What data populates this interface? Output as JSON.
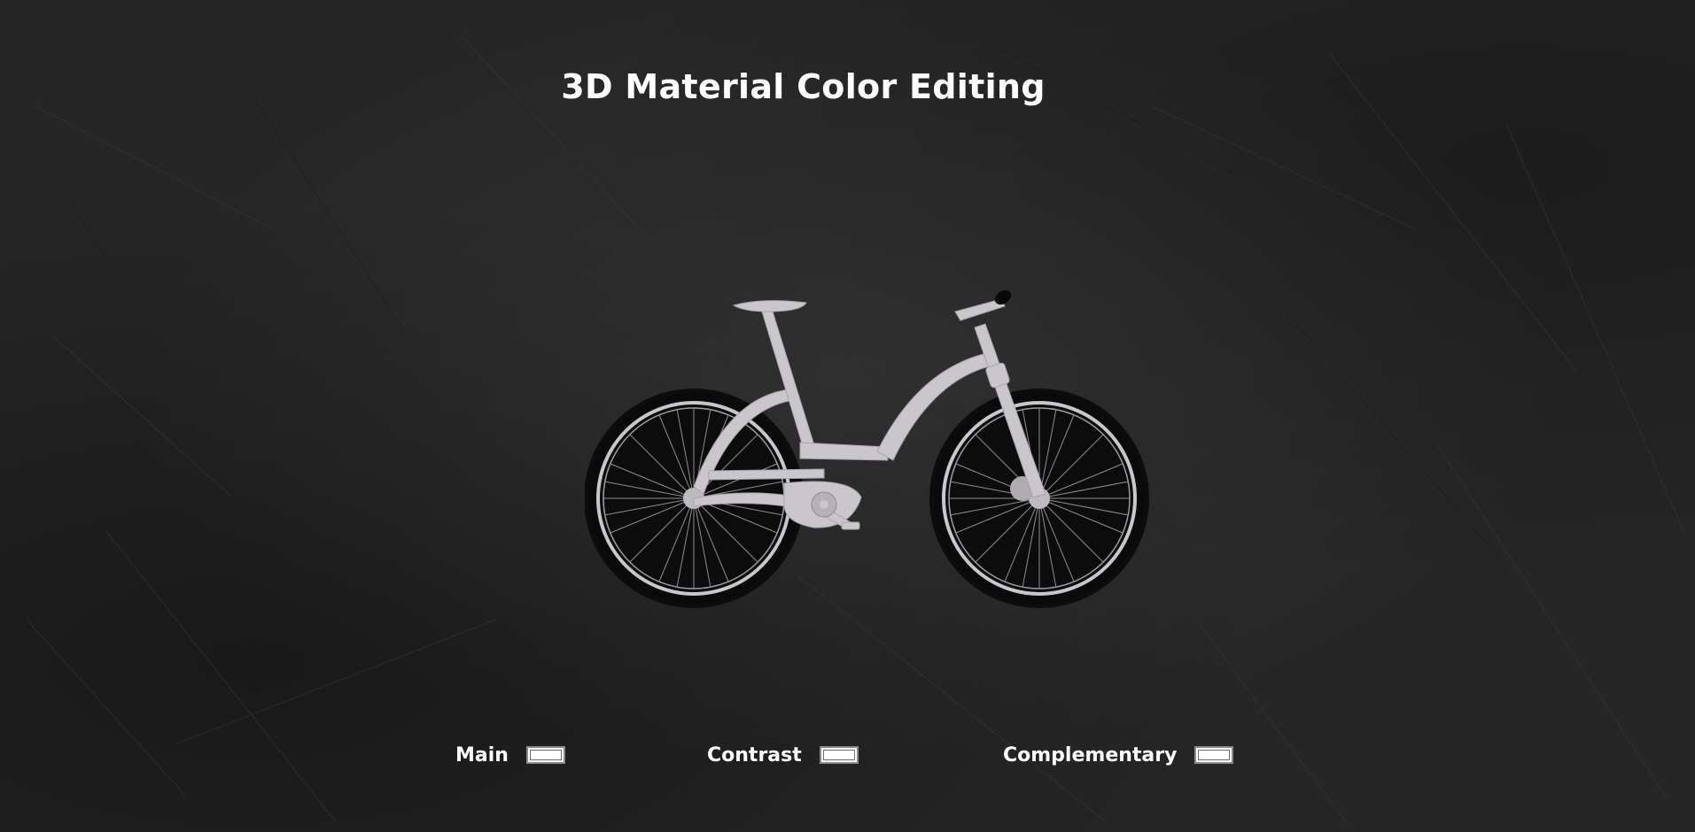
{
  "page": {
    "title": "3D Material Color Editing"
  },
  "scene": {
    "model_icon": "bicycle-model",
    "material_color": "#c9c7cb"
  },
  "controls": [
    {
      "label": "Main",
      "color": "#ffffff"
    },
    {
      "label": "Contrast",
      "color": "#ffffff"
    },
    {
      "label": "Complementary",
      "color": "#ffffff"
    }
  ],
  "colors": {
    "background": "#262626",
    "text": "#ffffff"
  }
}
